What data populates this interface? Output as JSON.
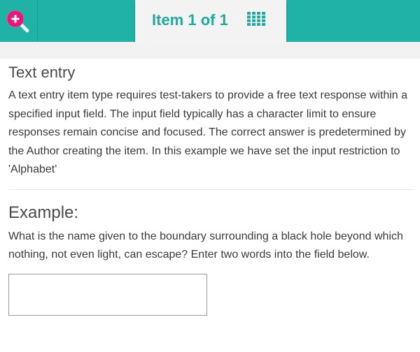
{
  "header": {
    "item_counter": "Item 1 of 1",
    "zoom_icon": "zoom-in-icon",
    "grid_icon": "grid-menu-icon",
    "colors": {
      "bar": "#20b2a6",
      "title": "#22a89d",
      "zoom_circle": "#e6177a"
    }
  },
  "main": {
    "title": "Text entry",
    "description": "A text entry item type requires test-takers to provide a free text response within a specified input field. The input field typically has a character limit to ensure responses remain concise and focused. The correct answer is predetermined by the Author creating the item. In this example we have set the input restriction to 'Alphabet'",
    "example": {
      "heading": "Example:",
      "question": "What is the name given to the boundary surrounding a black hole beyond which nothing, not even light, can escape? Enter two words into the field below.",
      "answer_value": ""
    }
  }
}
